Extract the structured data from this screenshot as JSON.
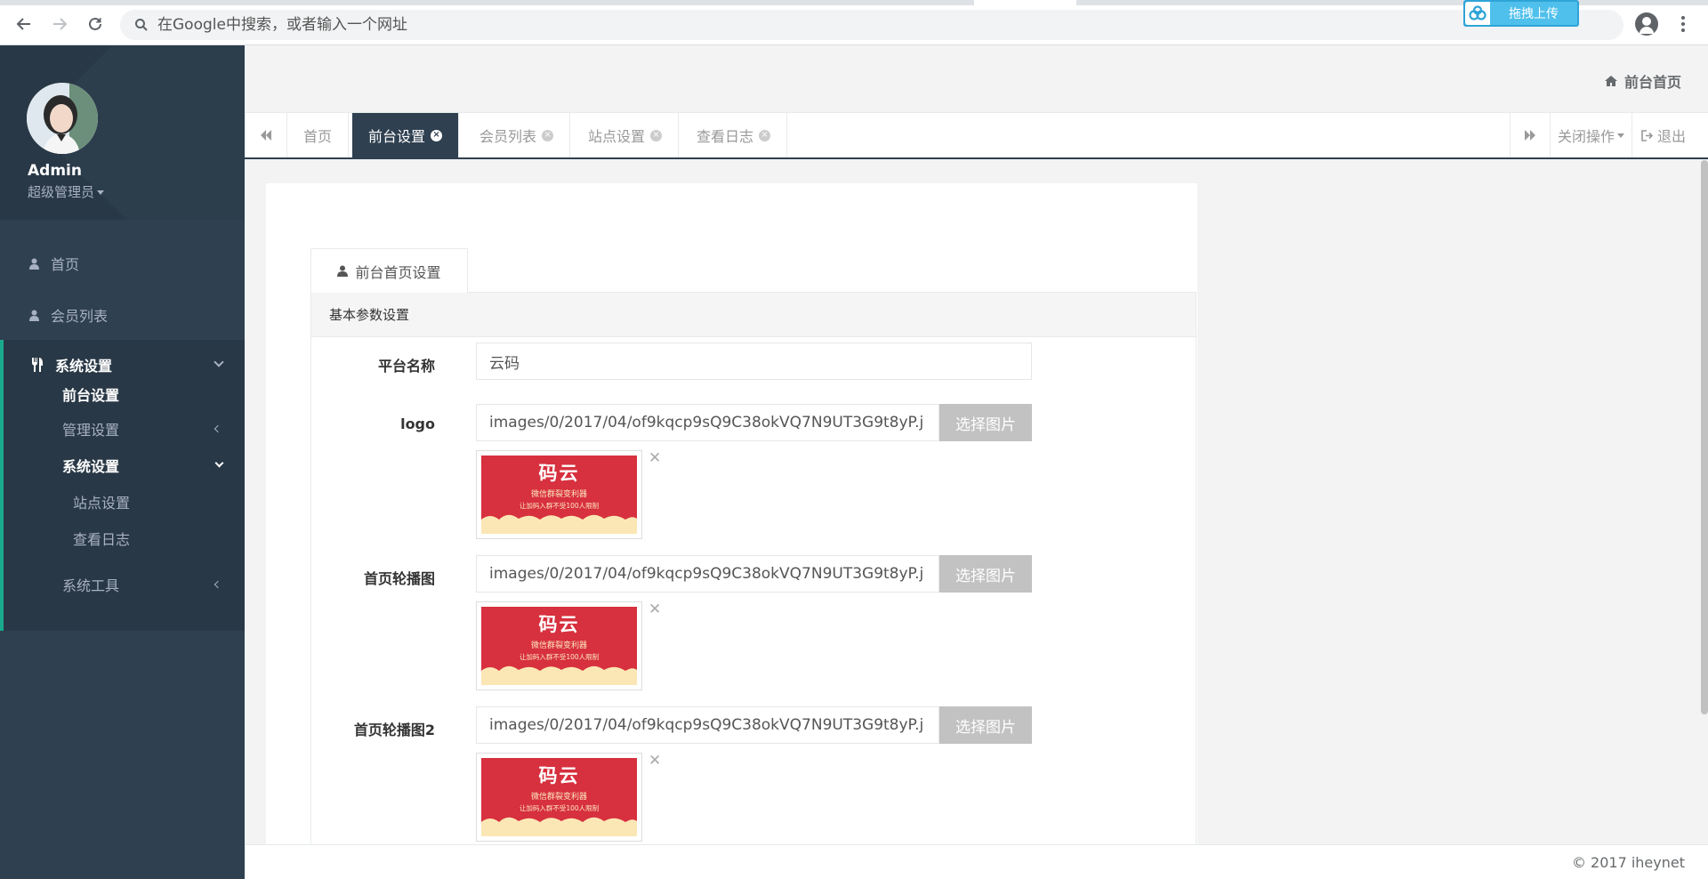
{
  "browser": {
    "omnibox_placeholder": "在Google中搜索，或者输入一个网址",
    "upload_badge": "拖拽上传"
  },
  "sidebar": {
    "user_name": "Admin",
    "user_role": "超级管理员",
    "items": [
      {
        "label": "首页",
        "icon": "user-icon"
      },
      {
        "label": "会员列表",
        "icon": "user-icon"
      }
    ],
    "active_group": {
      "label": "系统设置",
      "icon": "cutlery-icon",
      "children": [
        {
          "label": "前台设置",
          "active": true
        },
        {
          "label": "管理设置"
        },
        {
          "label": "系统设置"
        },
        {
          "label": "站点设置"
        },
        {
          "label": "查看日志"
        },
        {
          "label": "系统工具"
        }
      ]
    }
  },
  "header": {
    "breadcrumb": "前台首页"
  },
  "tabs": {
    "items": [
      "首页",
      "前台设置",
      "会员列表",
      "站点设置",
      "查看日志"
    ],
    "active_index": 1,
    "close_ops": "关闭操作",
    "logout": "退出"
  },
  "form": {
    "tab_title": "前台首页设置",
    "panel_title": "基本参数设置",
    "platform_name_label": "平台名称",
    "platform_name_value": "云码",
    "logo_label": "logo",
    "logo_value": "images/0/2017/04/of9kqcp9sQ9C38okVQ7N9UT3G9t8yP.j",
    "banner1_label": "首页轮播图",
    "banner1_value": "images/0/2017/04/of9kqcp9sQ9C38okVQ7N9UT3G9t8yP.j",
    "banner2_label": "首页轮播图2",
    "banner2_value": "images/0/2017/04/of9kqcp9sQ9C38okVQ7N9UT3G9t8yP.j",
    "pick_button": "选择图片",
    "thumb": {
      "title": "码云",
      "line1": "微信群裂变利器",
      "line2": "让加码入群不受100人限制"
    }
  },
  "footer": {
    "copyright": "© 2017 iheynet"
  },
  "colors": {
    "sidebar_bg": "#2f4050",
    "accent": "#19aa8d",
    "thumb_red": "#d7303e"
  }
}
